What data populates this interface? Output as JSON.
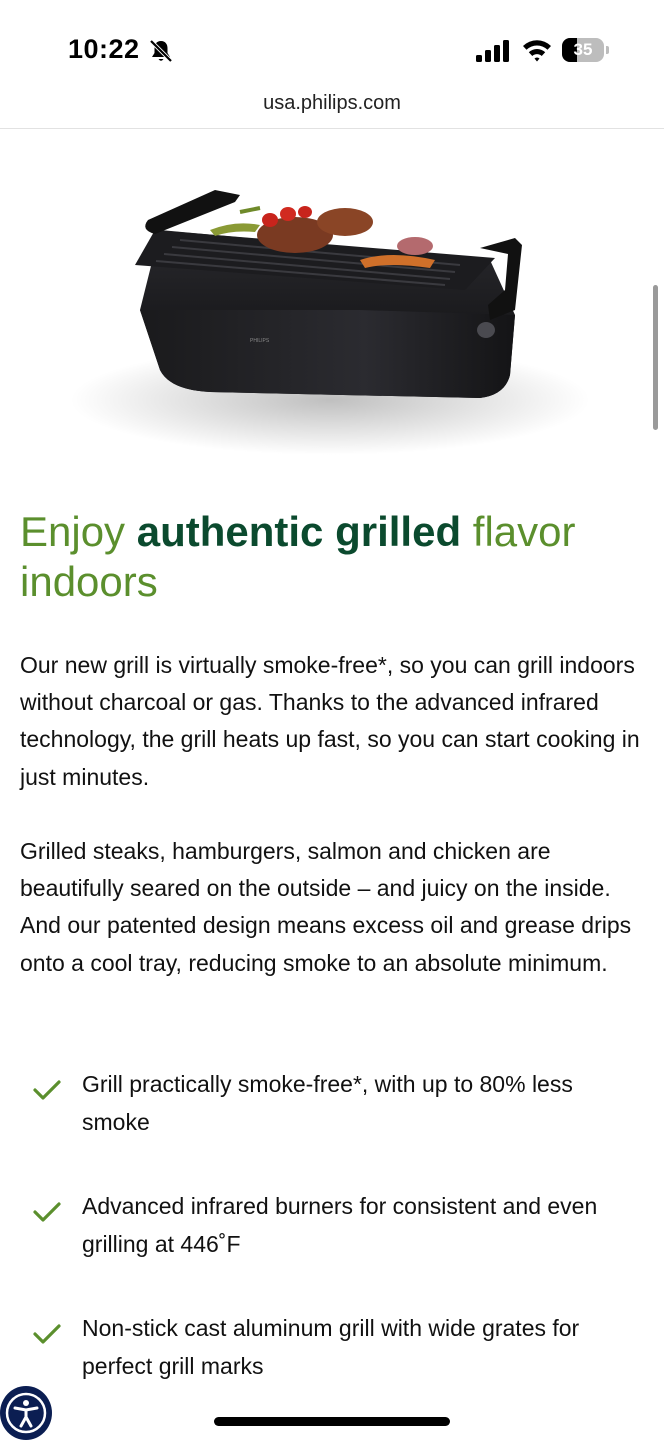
{
  "status_bar": {
    "time": "10:22",
    "battery_level": "35",
    "icons": [
      "bell-slash-icon",
      "signal-icon",
      "wifi-icon",
      "battery-icon"
    ]
  },
  "browser": {
    "url": "usa.philips.com"
  },
  "hero": {
    "brand_mark": "PHILIPS"
  },
  "headline": {
    "part1": "Enjoy ",
    "bold": "authentic grilled",
    "part2": " flavor indoors"
  },
  "body": {
    "paragraph1": "Our new grill is virtually smoke-free*, so you can grill indoors without charcoal or gas. Thanks to the advanced infrared technology, the grill heats up fast, so you can start cooking in just minutes.",
    "paragraph2": "Grilled steaks, hamburgers, salmon and chicken are beautifully seared on the outside – and juicy on the inside. And our patented design means excess oil and grease drips onto a cool tray, reducing smoke to an absolute minimum."
  },
  "features": [
    {
      "text": "Grill practically smoke-free*, with up to 80% less smoke",
      "icon": "check-icon"
    },
    {
      "text": "Advanced infrared burners for consistent and even grilling at 446˚F",
      "icon": "check-icon"
    },
    {
      "text": "Non-stick cast aluminum grill with wide grates for perfect grill marks",
      "icon": "check-icon"
    }
  ],
  "colors": {
    "headline_green": "#5b8f2d",
    "headline_dark_green": "#0b4a2e",
    "check_green": "#5b8f2d",
    "accessibility_navy": "#0b1e52"
  },
  "accessibility_button": {
    "icon": "accessibility-icon"
  }
}
